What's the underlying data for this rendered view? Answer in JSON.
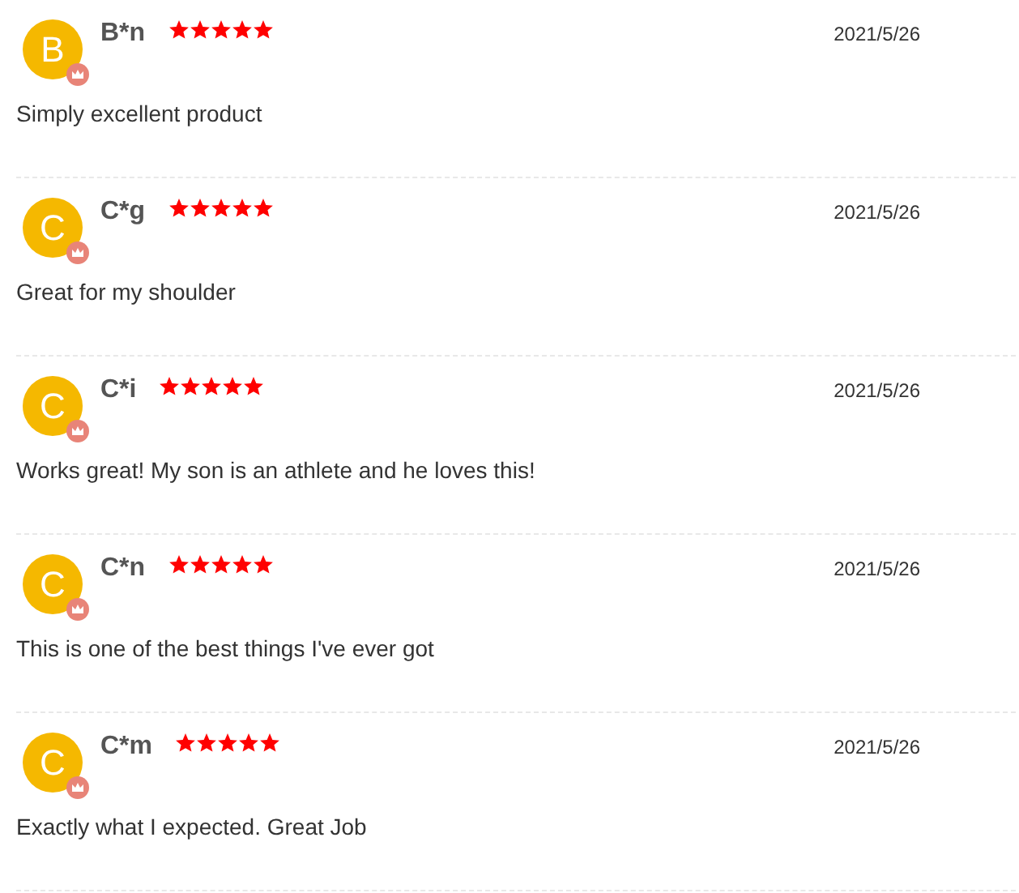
{
  "reviews": [
    {
      "initial": "B",
      "name": "B*n",
      "stars": 5,
      "date": "2021/5/26",
      "text": "Simply excellent product"
    },
    {
      "initial": "C",
      "name": "C*g",
      "stars": 5,
      "date": "2021/5/26",
      "text": "Great for my shoulder"
    },
    {
      "initial": "C",
      "name": "C*i",
      "stars": 5,
      "date": "2021/5/26",
      "text": "Works great! My son is an athlete and he loves this!"
    },
    {
      "initial": "C",
      "name": "C*n",
      "stars": 5,
      "date": "2021/5/26",
      "text": "This is one of the best things I've ever got"
    },
    {
      "initial": "C",
      "name": "C*m",
      "stars": 5,
      "date": "2021/5/26",
      "text": "Exactly what I expected. Great Job"
    }
  ]
}
